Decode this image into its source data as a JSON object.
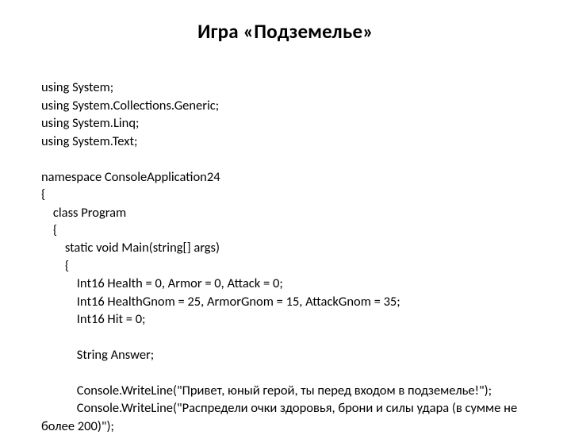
{
  "title": "Игра «Подземелье»",
  "lines": {
    "l1": "using System;",
    "l2": "using System.Collections.Generic;",
    "l3": "using System.Linq;",
    "l4": "using System.Text;",
    "l5": "",
    "l6": "namespace ConsoleApplication24",
    "l7": "{",
    "l8": "    class Program",
    "l9": "    {",
    "l10": "        static void Main(string[] args)",
    "l11": "        {",
    "l12": "            Int16 Health = 0, Armor = 0, Attack = 0;",
    "l13": "            Int16 HealthGnom = 25, ArmorGnom = 15, AttackGnom = 35;",
    "l14": "            Int16 Hit = 0;",
    "l15": "",
    "l16": "            String Answer;",
    "l17": "",
    "l18": "            Console.WriteLine(\"Привет, юный герой, ты перед входом в подземелье!\");",
    "l19": "            Console.WriteLine(\"Распредели очки здоровья, брони и силы удара (в сумме не более 200)\");"
  }
}
